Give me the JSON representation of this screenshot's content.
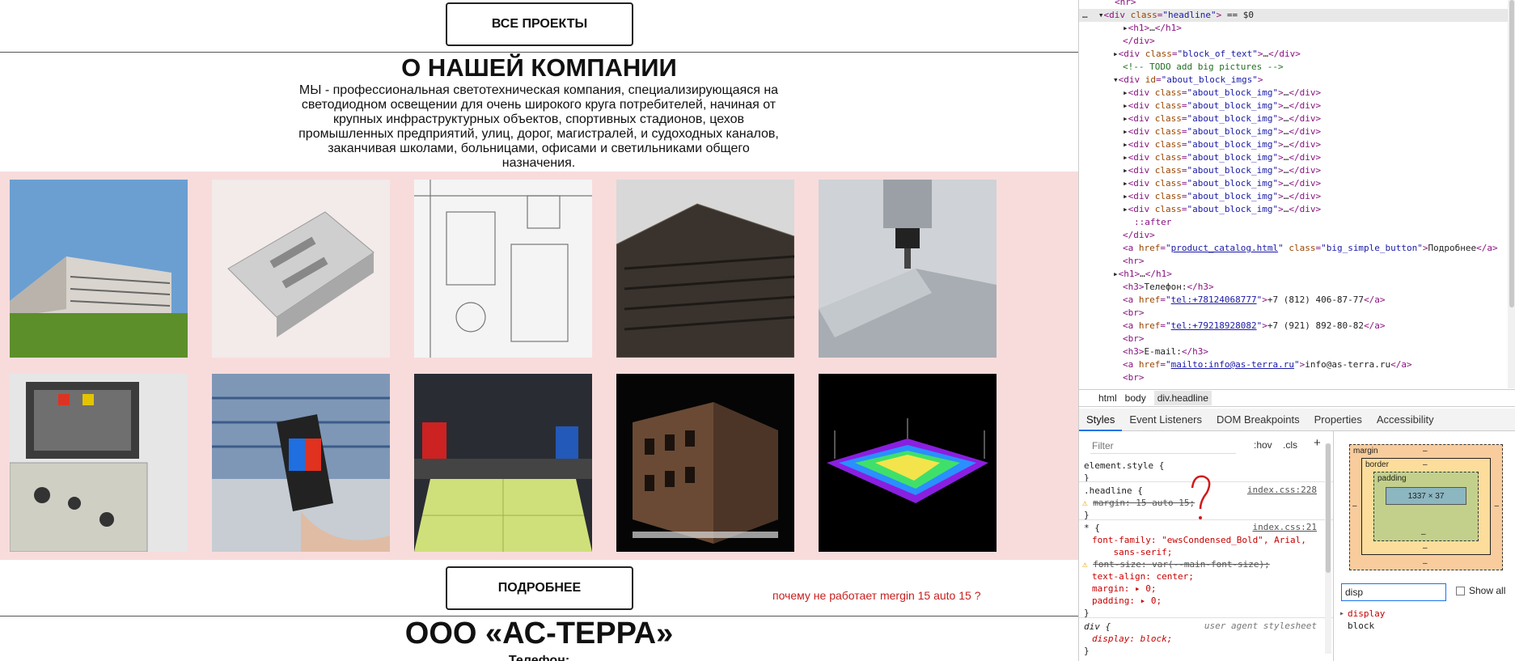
{
  "site": {
    "all_projects_button": "ВСЕ ПРОЕКТЫ",
    "about_heading": "О НАШЕЙ КОМПАНИИ",
    "about_lines": [
      "МЫ - профессиональная светотехническая компания, специализирующаяся на",
      "светодиодном освещении для очень широкого круга потребителей, начиная от",
      "крупных инфраструктурных объектов, спортивных стадионов, цехов",
      "промышленных предприятий, улиц, дорог, магистралей, и судоходных каналов,",
      "заканчивая школами, больницами, офисами и светильниками общего",
      "назначения."
    ],
    "gallery": [
      {
        "name": "factory-building-photo"
      },
      {
        "name": "led-panel-module-photo"
      },
      {
        "name": "technical-drawing-photo"
      },
      {
        "name": "stacked-led-modules-photo"
      },
      {
        "name": "cnc-milling-photo"
      },
      {
        "name": "lab-equipment-photo"
      },
      {
        "name": "spectrometer-hand-photo"
      },
      {
        "name": "ice-arena-photo"
      },
      {
        "name": "illuminated-building-photo"
      },
      {
        "name": "stadium-light-simulation-photo"
      }
    ],
    "more_button": "ПОДРОБНЕЕ",
    "note": "почему не работает mergin 15 auto 15 ?",
    "company_heading": "ООО «АС-ТЕРРА»",
    "phone_partial": "Телефон:"
  },
  "devtools": {
    "breadcrumbs": [
      "html",
      "body",
      "div.headline"
    ],
    "tabs": [
      "Styles",
      "Event Listeners",
      "DOM Breakpoints",
      "Properties",
      "Accessibility"
    ],
    "active_tab": "Styles",
    "filter_placeholder": "Filter",
    "hov": ":hov",
    "cls": ".cls",
    "plus": "+",
    "element_style": "element.style {",
    "headline_selector": ".headline {",
    "headline_src": "index.css:228",
    "headline_prop": "margin: 15 auto 15;",
    "star_selector": "* {",
    "star_src": "index.css:21",
    "star_props": [
      "font-family: \"ewsCondensed_Bold\", Arial,",
      "    sans-serif;",
      "font-size: var(--main-font-size);",
      "text-align: center;",
      "margin: ▸ 0;",
      "padding: ▸ 0;"
    ],
    "div_selector": "div {",
    "ua_label": "user agent stylesheet",
    "div_prop": "display: block;",
    "box": {
      "margin": "margin",
      "border": "border",
      "padding": "padding",
      "content": "1337 × 37",
      "dash": "–"
    },
    "computed_filter": "disp",
    "show_all": "Show all",
    "computed_prop": "display",
    "computed_val": "block",
    "colors": {
      "accent": "#1a73e8",
      "margin": "#f9cc9d",
      "border": "#fddd9b",
      "padding": "#c3d08b",
      "content": "#8cb6c0"
    }
  }
}
